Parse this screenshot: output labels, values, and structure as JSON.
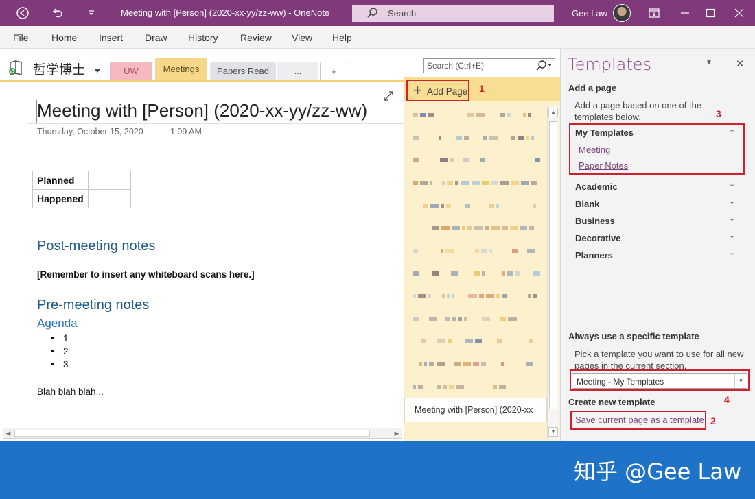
{
  "window": {
    "title": "Meeting with [Person] (2020-xx-yy/zz-ww)  -  OneNote",
    "search_placeholder": "Search",
    "user": "Gee Law"
  },
  "menu": [
    "File",
    "Home",
    "Insert",
    "Draw",
    "History",
    "Review",
    "View",
    "Help"
  ],
  "notebook": {
    "name": "哲学博士",
    "tabs": [
      "UW",
      "Meetings",
      "Papers Read",
      "...",
      "+"
    ],
    "search_placeholder": "Search (Ctrl+E)"
  },
  "page": {
    "title": "Meeting with [Person] (2020-xx-yy/zz-ww)",
    "date": "Thursday, October 15, 2020",
    "time": "1:09 AM",
    "table": [
      "Planned",
      "Happened"
    ],
    "post_heading": "Post-meeting notes",
    "remember": "[Remember to insert any whiteboard scans here.]",
    "pre_heading": "Pre-meeting notes",
    "agenda_heading": "Agenda",
    "agenda_items": [
      "1",
      "2",
      "3"
    ],
    "blah": "Blah blah blah..."
  },
  "page_list": {
    "add_page": "Add Page",
    "selected": "Meeting with [Person] (2020-xx"
  },
  "templates_pane": {
    "title": "Templates",
    "add_a_page": "Add a page",
    "add_desc_1": "Add a page based on one of the",
    "add_desc_2": "templates below.",
    "my_templates": "My Templates",
    "my_items": [
      "Meeting",
      "Paper Notes"
    ],
    "groups": [
      "Academic",
      "Blank",
      "Business",
      "Decorative",
      "Planners"
    ],
    "always_heading": "Always use a specific template",
    "always_desc_1": "Pick a template you want to use for all new",
    "always_desc_2": "pages in the current section.",
    "selected_template": "Meeting - My Templates",
    "create_heading": "Create new template",
    "save_link": "Save current page as a template"
  },
  "annotations": [
    "1",
    "2",
    "3",
    "4"
  ],
  "watermark": "知乎 @Gee Law",
  "colors": {
    "title_bar": "#80397b",
    "annotation_red": "#d0202e",
    "footer": "#1e73c8",
    "heading_blue": "#1f5a8c"
  }
}
